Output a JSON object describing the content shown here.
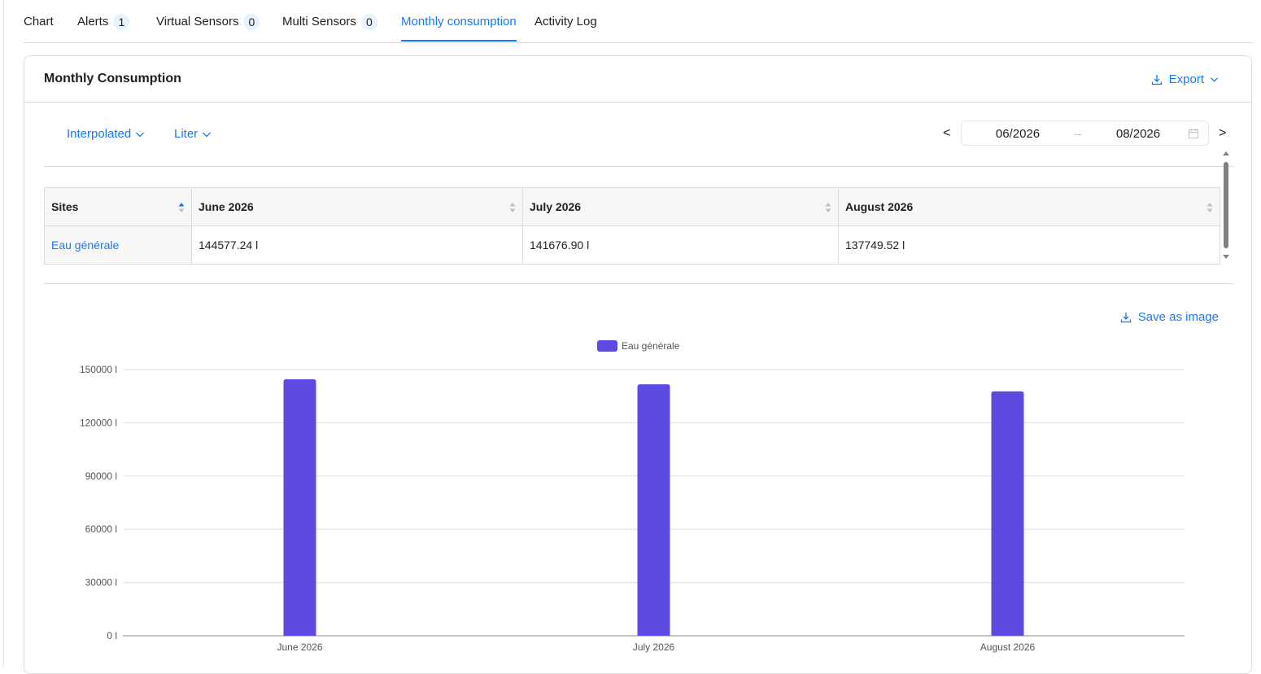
{
  "tabs": [
    {
      "label": "Chart"
    },
    {
      "label": "Alerts",
      "badge": "1"
    },
    {
      "label": "Virtual Sensors",
      "badge": "0"
    },
    {
      "label": "Multi Sensors",
      "badge": "0"
    },
    {
      "label": "Monthly consumption",
      "active": true
    },
    {
      "label": "Activity Log"
    }
  ],
  "card": {
    "title": "Monthly Consumption",
    "export_label": "Export"
  },
  "filters": {
    "mode": "Interpolated",
    "unit": "Liter"
  },
  "date_range": {
    "prev": "<",
    "next": ">",
    "start": "06/2026",
    "separator": "→",
    "end": "08/2026"
  },
  "table": {
    "headers": [
      "Sites",
      "June 2026",
      "July 2026",
      "August 2026"
    ],
    "rows": [
      {
        "site": "Eau générale",
        "values": [
          "144577.24 l",
          "141676.90 l",
          "137749.52 l"
        ]
      }
    ]
  },
  "save_image_label": "Save as image",
  "colors": {
    "accent": "#1677ff",
    "bar": "#5d4ae0"
  },
  "chart_data": {
    "type": "bar",
    "categories": [
      "June 2026",
      "July 2026",
      "August 2026"
    ],
    "series": [
      {
        "name": "Eau générale",
        "values": [
          144577.24,
          141676.9,
          137749.52
        ]
      }
    ],
    "ylim": [
      0,
      150000
    ],
    "yticks": [
      0,
      30000,
      60000,
      90000,
      120000,
      150000
    ],
    "ytick_labels": [
      "0 l",
      "30000 l",
      "60000 l",
      "90000 l",
      "120000 l",
      "150000 l"
    ],
    "legend": "top-center",
    "grid": true
  }
}
